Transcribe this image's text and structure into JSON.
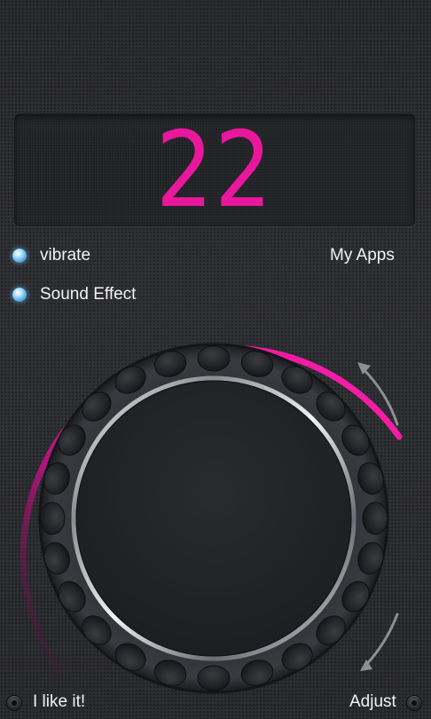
{
  "counter": {
    "value": "22",
    "color": "#e8179c"
  },
  "options": {
    "vibrate_label": "vibrate",
    "sound_effect_label": "Sound Effect",
    "indicator_color": "#7cc6f2"
  },
  "header_links": {
    "my_apps_label": "My Apps"
  },
  "dial": {
    "arc_color": "#e8179c",
    "icons": [
      "rotate-arrow-top-icon",
      "rotate-arrow-bottom-icon"
    ]
  },
  "footer": {
    "like_label": "I like it!",
    "adjust_label": "Adjust",
    "icons": [
      "screw-left-icon",
      "screw-right-icon"
    ]
  }
}
